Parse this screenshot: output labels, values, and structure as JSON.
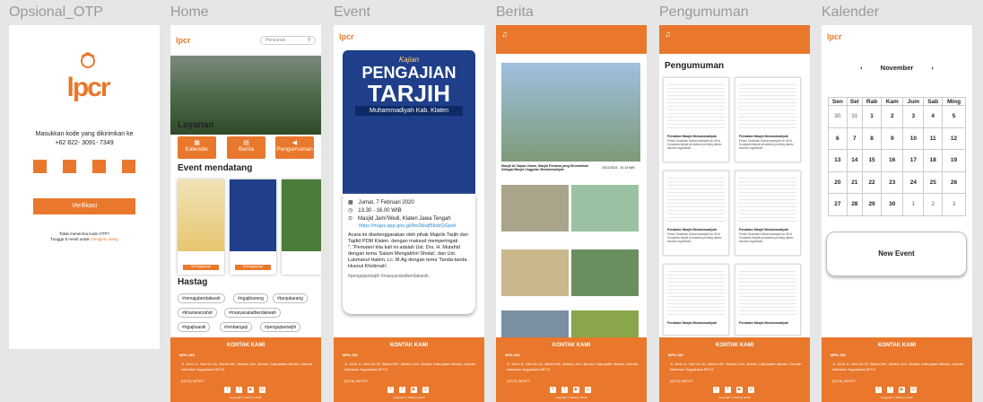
{
  "frames": {
    "otp": "Opsional_OTP",
    "home": "Home",
    "event": "Event",
    "berita": "Berita",
    "pengumuman": "Pengumuman",
    "kalender": "Kalender"
  },
  "otp": {
    "logo": "lpcr",
    "line1": "Masukkan kode yang dikirimkan ke",
    "phone": "+62 822- 3091- 7349",
    "verify": "Verifikasi",
    "no_code": "Tidak menerima kode OTP?",
    "wait": "Tunggu 5 menit untuk",
    "resend": "mengirim ulang"
  },
  "home": {
    "search_placeholder": "Pencarian",
    "layanan": "Layanan",
    "services": [
      "Kalender",
      "Berita",
      "Pengumuman"
    ],
    "event_title": "Event mendatang",
    "event_btn": "Selengkapnya",
    "hastag_title": "Hastag",
    "tags": [
      "#remajaberdakwah",
      "#ngajibareng",
      "#tanjukarang",
      "#khanwarzahid",
      "#masyarakatberdakwah",
      "#ngajituasik",
      "#ombangaji",
      "#pengajiantarjih"
    ]
  },
  "event": {
    "poster_pre": "Kajian",
    "poster_title1": "PENGAJIAN",
    "poster_title2": "TARJIH",
    "poster_sub": "Muhammadiyah Kab. Klaten",
    "date": "Jumat, 7 Februari 2020",
    "time": "13.30 - 16.00 WIB",
    "place": "Masjid Jami'Wedi, Klaten Jawa Tengah",
    "link": "https://maps.app.goo.gl/8m2kkqf58dzQGpsk",
    "desc": "Acara ini diselenggarakan oleh pihak Majelis Tarjih dan Tajdid PDM Klaten. dengan maksud memperingati \"..\"Pemateri kita kali ini adalah Ust. Drs. H. Mutahid dengan tema 'Salam Mengakhiri Sholat', dan Ust. Lukmanul Hakim, Lc. M.Ag dengan tema 'Tanda-tanda Husnul Khotimah'.",
    "hashtags": "#pengajiantarjih #masyarakatberdakwah"
  },
  "berita": {
    "main_title": "Masjid At-Taqwa Umum, Masjid Pertama yang Dirumahkan Sebagai Masjid Unggulan Muhammadiyah",
    "main_date": "20/11/2023 - 10.13 WIB"
  },
  "pengumuman": {
    "title": "Pengumuman",
    "doc_title": "Peralatan Masjid Muhammadiyah",
    "doc_text": "Pesan Mudahan Muhammadiyah ke-48 di Surakarta terjadi perubahan penting dalam struktur organisasi..."
  },
  "kalender": {
    "month": "November",
    "days": [
      "Sen",
      "Sel",
      "Rab",
      "Kam",
      "Jum",
      "Sab",
      "Ming"
    ],
    "weeks": [
      [
        "30",
        "31",
        "1",
        "2",
        "3",
        "4",
        "5"
      ],
      [
        "6",
        "7",
        "8",
        "9",
        "10",
        "11",
        "12"
      ],
      [
        "13",
        "14",
        "15",
        "16",
        "17",
        "18",
        "19"
      ],
      [
        "20",
        "21",
        "22",
        "23",
        "24",
        "25",
        "26"
      ],
      [
        "27",
        "28",
        "29",
        "30",
        "1",
        "2",
        "3"
      ]
    ],
    "new_event": "New Event"
  },
  "footer": {
    "title": "KONTAK KAMI",
    "org": "MPK-SDI",
    "address": "Jl. Jend. A. Yani No.31, Bantul Wt., Bantul, Kec. Bantul, Kabupaten Bantul, Daerah Istimewa Yogyakarta 55711",
    "phone": "(0274) 387577",
    "copy": "Copyright © 2022 ||| LPCR"
  },
  "colors": {
    "accent": "#e9782c",
    "poster": "#1f3f8a"
  }
}
